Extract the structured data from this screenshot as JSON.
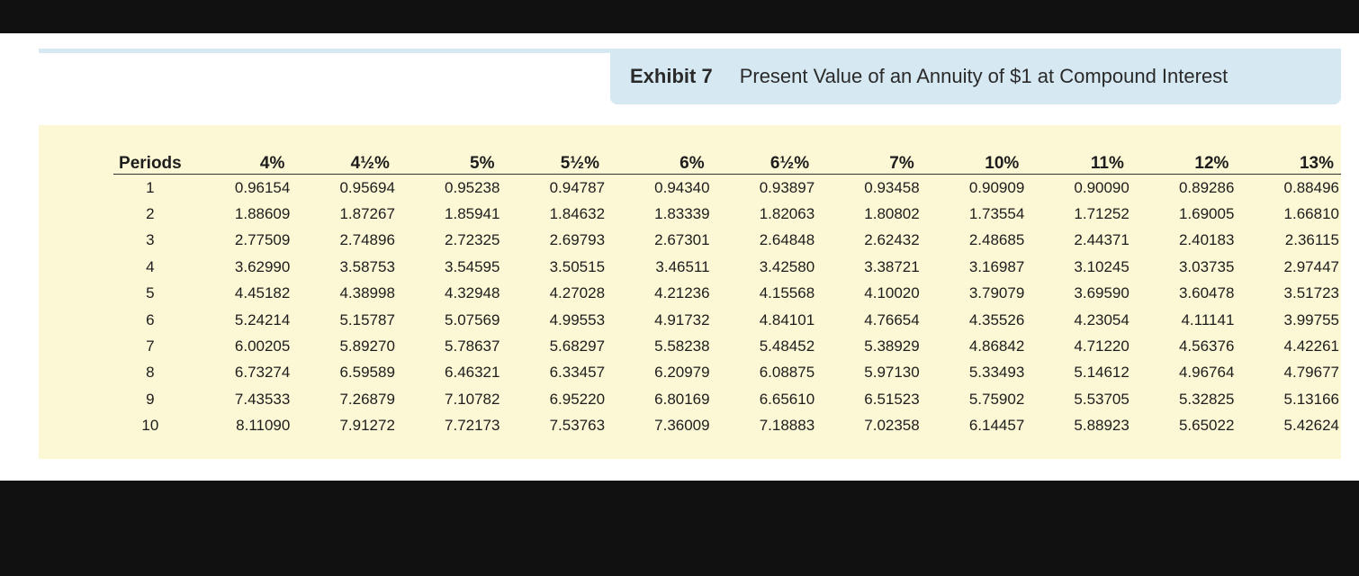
{
  "exhibit": {
    "label": "Exhibit 7",
    "title": "Present Value of an Annuity of $1 at Compound Interest"
  },
  "table": {
    "headers": [
      "Periods",
      "4%",
      "4½%",
      "5%",
      "5½%",
      "6%",
      "6½%",
      "7%",
      "10%",
      "11%",
      "12%",
      "13%"
    ],
    "rows": [
      [
        "1",
        "0.96154",
        "0.95694",
        "0.95238",
        "0.94787",
        "0.94340",
        "0.93897",
        "0.93458",
        "0.90909",
        "0.90090",
        "0.89286",
        "0.88496"
      ],
      [
        "2",
        "1.88609",
        "1.87267",
        "1.85941",
        "1.84632",
        "1.83339",
        "1.82063",
        "1.80802",
        "1.73554",
        "1.71252",
        "1.69005",
        "1.66810"
      ],
      [
        "3",
        "2.77509",
        "2.74896",
        "2.72325",
        "2.69793",
        "2.67301",
        "2.64848",
        "2.62432",
        "2.48685",
        "2.44371",
        "2.40183",
        "2.36115"
      ],
      [
        "4",
        "3.62990",
        "3.58753",
        "3.54595",
        "3.50515",
        "3.46511",
        "3.42580",
        "3.38721",
        "3.16987",
        "3.10245",
        "3.03735",
        "2.97447"
      ],
      [
        "5",
        "4.45182",
        "4.38998",
        "4.32948",
        "4.27028",
        "4.21236",
        "4.15568",
        "4.10020",
        "3.79079",
        "3.69590",
        "3.60478",
        "3.51723"
      ],
      [
        "6",
        "5.24214",
        "5.15787",
        "5.07569",
        "4.99553",
        "4.91732",
        "4.84101",
        "4.76654",
        "4.35526",
        "4.23054",
        "4.11141",
        "3.99755"
      ],
      [
        "7",
        "6.00205",
        "5.89270",
        "5.78637",
        "5.68297",
        "5.58238",
        "5.48452",
        "5.38929",
        "4.86842",
        "4.71220",
        "4.56376",
        "4.42261"
      ],
      [
        "8",
        "6.73274",
        "6.59589",
        "6.46321",
        "6.33457",
        "6.20979",
        "6.08875",
        "5.97130",
        "5.33493",
        "5.14612",
        "4.96764",
        "4.79677"
      ],
      [
        "9",
        "7.43533",
        "7.26879",
        "7.10782",
        "6.95220",
        "6.80169",
        "6.65610",
        "6.51523",
        "5.75902",
        "5.53705",
        "5.32825",
        "5.13166"
      ],
      [
        "10",
        "8.11090",
        "7.91272",
        "7.72173",
        "7.53763",
        "7.36009",
        "7.18883",
        "7.02358",
        "6.14457",
        "5.88923",
        "5.65022",
        "5.42624"
      ]
    ]
  },
  "colors": {
    "caption_bg": "#d6e8f2",
    "table_bg": "#fcf7d4",
    "frame_bg": "#111111"
  }
}
